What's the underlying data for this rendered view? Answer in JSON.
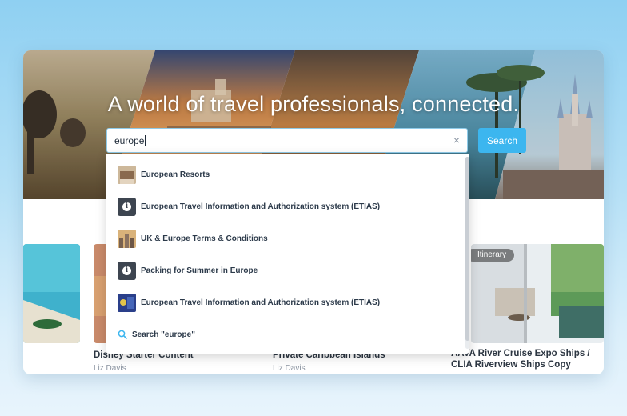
{
  "hero": {
    "headline": "A world of travel professionals, connected."
  },
  "search": {
    "value": "europe",
    "clear_symbol": "×",
    "button_label": "Search"
  },
  "dropdown": {
    "results": [
      {
        "label": "European Resorts",
        "icon": "resort-thumbnail"
      },
      {
        "label": "European Travel Information and Authorization system (ETIAS)",
        "icon": "info-icon"
      },
      {
        "label": "UK & Europe Terms & Conditions",
        "icon": "city-thumbnail"
      },
      {
        "label": "Packing for Summer in Europe",
        "icon": "info-icon"
      },
      {
        "label": "European Travel Information and Authorization system (ETIAS)",
        "icon": "flag-thumbnail"
      }
    ],
    "search_all_label": "Search \"europe\"",
    "info_glyph": "i"
  },
  "tiles": [
    {
      "title": "Disney Starter Content",
      "author": "Liz Davis"
    },
    {
      "title": "Private Caribbean Islands",
      "author": "Liz Davis"
    },
    {
      "title": "AAVA River Cruise Expo Ships / CLIA Riverview Ships Copy",
      "author": "",
      "badge": "Itinerary"
    }
  ],
  "colors": {
    "accent": "#3cb6ef",
    "text_dark": "#2c3a4a",
    "muted": "#8a93a0"
  }
}
